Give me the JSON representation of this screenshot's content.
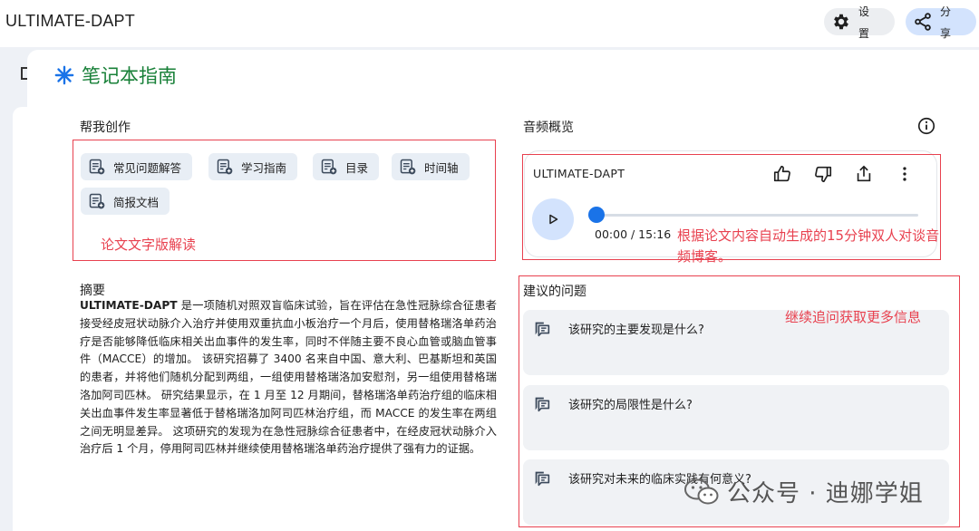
{
  "app": {
    "title": "ULTIMATE-DAPT"
  },
  "toolbar": {
    "settings_chars": [
      "设",
      "置"
    ],
    "share_chars": [
      "分",
      "享"
    ]
  },
  "guide": {
    "title": "笔记本指南"
  },
  "create": {
    "label": "帮我创作",
    "chips": [
      "常见问题解答",
      "学习指南",
      "目录",
      "时间轴",
      "简报文档"
    ],
    "annotation": "论文文字版解读"
  },
  "summary": {
    "title": "摘要",
    "lead": "ULTIMATE-DAPT",
    "body": " 是一项随机对照双盲临床试验，旨在评估在急性冠脉综合征患者接受经皮冠状动脉介入治疗并使用双重抗血小板治疗一个月后，使用替格瑞洛单药治疗是否能够降低临床相关出血事件的发生率，同时不伴随主要不良心血管或脑血管事件（MACCE）的增加。 该研究招募了 3400 名来自中国、意大利、巴基斯坦和英国的患者，并将他们随机分配到两组，一组使用替格瑞洛加安慰剂，另一组使用替格瑞洛加阿司匹林。 研究结果显示，在 1 月至 12 月期间，替格瑞洛单药治疗组的临床相关出血事件发生率显著低于替格瑞洛加阿司匹林治疗组，而 MACCE 的发生率在两组之间无明显差异。 这项研究的发现为在急性冠脉综合征患者中，在经皮冠状动脉介入治疗后 1 个月，停用阿司匹林并继续使用替格瑞洛单药治疗提供了强有力的证据。"
  },
  "audio": {
    "label": "音频概览",
    "name": "ULTIMATE-DAPT",
    "time": "00:00 / 15:16",
    "progress": 0,
    "annotation": "根据论文内容自动生成的15分钟双人对谈音频博客。"
  },
  "questions": {
    "label": "建议的问题",
    "annotation": "继续追问获取更多信息",
    "items": [
      "该研究的主要发现是什么?",
      "该研究的局限性是什么?",
      "该研究对未来的临床实践有何意义?"
    ]
  },
  "watermark": {
    "text": "公众号 · 迪娜学姐"
  },
  "colors": {
    "annotation_red": "#e8414f",
    "guide_green": "#188038",
    "accent_blue": "#1a73e8"
  }
}
